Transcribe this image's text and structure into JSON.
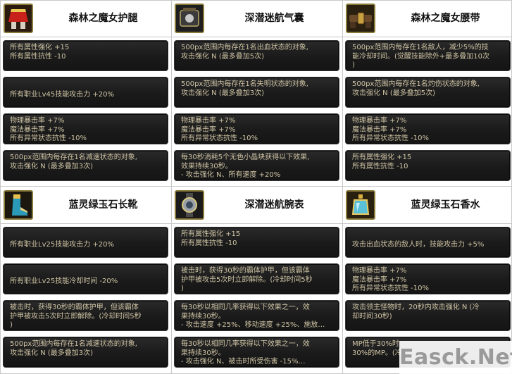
{
  "colors": {
    "panel_bg": "#1a1a1a",
    "panel_text": "#cfc4a4",
    "header_bg": "#ffffff",
    "title_text": "#111111"
  },
  "columns": [
    {
      "sections": [
        {
          "title": "森林之魔女护腿",
          "icon": "red-skirt-leggings-icon",
          "rows": [
            {
              "lines": [
                "所有属性强化 +15",
                "所有属性抗性 -10"
              ]
            },
            {
              "lines": [
                "所有职业Lv45技能攻击力 +20%"
              ]
            },
            {
              "lines": [
                "物理暴击率 +7%",
                "魔法暴击率 +7%",
                "所有异常状态抗性 -10%"
              ]
            },
            {
              "lines": [
                "500px范围内每存在1名减速状态的对象,",
                "攻击强化 N (最多叠加3次)"
              ]
            }
          ]
        },
        {
          "title": "蓝灵绿玉石长靴",
          "icon": "jade-boots-icon",
          "rows": [
            {
              "lines": [
                "所有职业Lv25技能攻击力 +20%"
              ]
            },
            {
              "lines": [
                "所有职业Lv25技能冷却时间 -20%"
              ]
            },
            {
              "lines": [
                "被击时，获得30秒的霸体护甲，但该霸体",
                "护甲被攻击5次时立即解除。(冷却时间5秒",
                ")"
              ]
            },
            {
              "lines": [
                "500px范围内每存在1名减速状态的对象,",
                "攻击强化 N (最多叠加3次)"
              ]
            }
          ]
        }
      ]
    },
    {
      "sections": [
        {
          "title": "深潜迷航气囊",
          "icon": "diving-airbag-icon",
          "rows": [
            {
              "lines": [
                "500px范围内每存在1名出血状态的对象,",
                "攻击强化 N (最多叠加5次)"
              ]
            },
            {
              "lines": [
                "500px范围内每存在1名失明状态的对象,",
                "攻击强化 N (最多叠加3次)"
              ]
            },
            {
              "lines": [
                "物理暴击率 +7%",
                "魔法暴击率 +7%",
                "所有异常状态抗性 -10%"
              ]
            },
            {
              "lines": [
                "每30秒消耗5个无色小晶块获得以下效果,",
                "效果持续30秒。",
                "- 攻击强化 N、所有速度 +20%"
              ]
            }
          ]
        },
        {
          "title": "深潜迷航腕表",
          "icon": "diving-wristwatch-icon",
          "rows": [
            {
              "lines": [
                "所有属性强化 +15",
                "所有属性抗性 -10"
              ]
            },
            {
              "lines": [
                "被击时，获得30秒的霸体护甲，但该霸体",
                "护甲被攻击5次时立即解除。(冷却时间5秒",
                ")"
              ]
            },
            {
              "lines": [
                "每30秒以相同几率获得以下效果之一，效",
                "果持续30秒。",
                "- 攻击速度 +25%、移动速度 +25%、施放…"
              ]
            },
            {
              "lines": [
                "每30秒以相同几率获得以下效果之一，效",
                "果持续30秒。",
                "- 攻击强化 N、被击时所受伤害 -15%…"
              ]
            }
          ]
        }
      ]
    },
    {
      "sections": [
        {
          "title": "森林之魔女腰带",
          "icon": "witch-belt-icon",
          "rows": [
            {
              "lines": [
                "500px范围内每存在1名敌人，减少5%的技",
                "能冷却时间。(觉醒技能除外+最多叠加10次",
                ")"
              ]
            },
            {
              "lines": [
                "500px范围内每存在1名灼伤状态的对象,",
                "攻击强化 N (最多叠加5次)"
              ]
            },
            {
              "lines": [
                "物理暴击率 +7%",
                "魔法暴击率 +7%",
                "所有异常状态抗性 -10%"
              ]
            },
            {
              "lines": [
                "所有属性强化 +15",
                "所有属性抗性 -10"
              ]
            }
          ]
        },
        {
          "title": "蓝灵绿玉石香水",
          "icon": "jade-perfume-icon",
          "rows": [
            {
              "lines": [
                "攻击出血状态的敌人时，技能攻击力 +5%"
              ]
            },
            {
              "lines": [
                "物理暴击率 +7%",
                "魔法暴击率 +7%",
                "所有异常状态抗性 -10%"
              ]
            },
            {
              "lines": [
                "攻击领主怪物时，20秒内攻击强化 N (冷",
                "却时间30秒)"
              ]
            },
            {
              "lines": [
                "MP低于30%时",
                "30%的MP。(冷"
              ]
            }
          ]
        }
      ]
    }
  ],
  "watermark": "Easck.Net"
}
